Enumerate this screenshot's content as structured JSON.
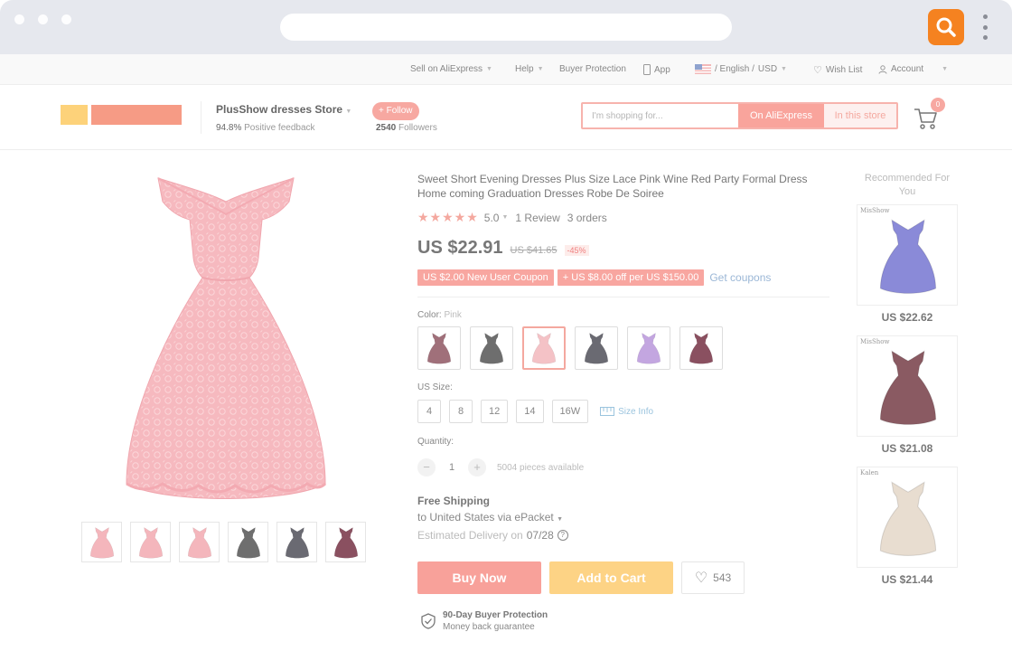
{
  "topbar": {
    "sell": "Sell on AliExpress",
    "help": "Help",
    "protection": "Buyer Protection",
    "app": "App",
    "lang": "/ English /",
    "currency": "USD",
    "wishlist": "Wish List",
    "account": "Account"
  },
  "store": {
    "name": "PlusShow dresses Store",
    "feedback_pct": "94.8%",
    "feedback_label": "Positive feedback",
    "follow_label": "+ Follow",
    "followers_count": "2540",
    "followers_label": "Followers",
    "search_placeholder": "I'm shopping for...",
    "search_aliexpress": "On AliExpress",
    "search_store": "In this store",
    "cart_count": "0"
  },
  "product": {
    "title": "Sweet Short Evening Dresses Plus Size Lace Pink Wine Red Party Formal Dress Home coming Graduation Dresses Robe De Soiree",
    "stars": "★★★★★",
    "rating": "5.0",
    "reviews": "1 Review",
    "orders": "3 orders",
    "price": "US $22.91",
    "old_price": "US $41.65",
    "discount": "-45%",
    "coupon1": "US $2.00 New User Coupon",
    "coupon2": "+ US $8.00 off per US $150.00",
    "get_coupons": "Get coupons",
    "color_label": "Color:",
    "color_value": "Pink",
    "colors": [
      "#a0707a",
      "#6e6e6e",
      "#f4c2c6",
      "#6a6a72",
      "#c3a6e0",
      "#8a5060"
    ],
    "selected_color_index": 2,
    "size_label": "US Size:",
    "sizes": [
      "4",
      "8",
      "12",
      "14",
      "16W"
    ],
    "size_info": "Size Info",
    "quantity_label": "Quantity:",
    "quantity": "1",
    "available": "5004 pieces available",
    "shipping_title": "Free Shipping",
    "shipping_dest": "to United States via ePacket",
    "estimated_label": "Estimated Delivery on",
    "estimated_date": "07/28",
    "buy_now": "Buy Now",
    "add_to_cart": "Add to Cart",
    "wish_count": "543",
    "protection_title": "90-Day Buyer Protection",
    "protection_sub": "Money back guarantee"
  },
  "thumb_colors": [
    "#f4b6bc",
    "#f4b6bc",
    "#f4b6bc",
    "#6e6e6e",
    "#6a6a72",
    "#8a5060"
  ],
  "recommended": {
    "title": "Recommended For You",
    "items": [
      {
        "brand": "MisShow",
        "price": "US $22.62",
        "color": "#8a8ad8"
      },
      {
        "brand": "MisShow",
        "price": "US $21.08",
        "color": "#8a5a62"
      },
      {
        "brand": "Kalen",
        "price": "US $21.44",
        "color": "#e8ddd0"
      }
    ]
  }
}
